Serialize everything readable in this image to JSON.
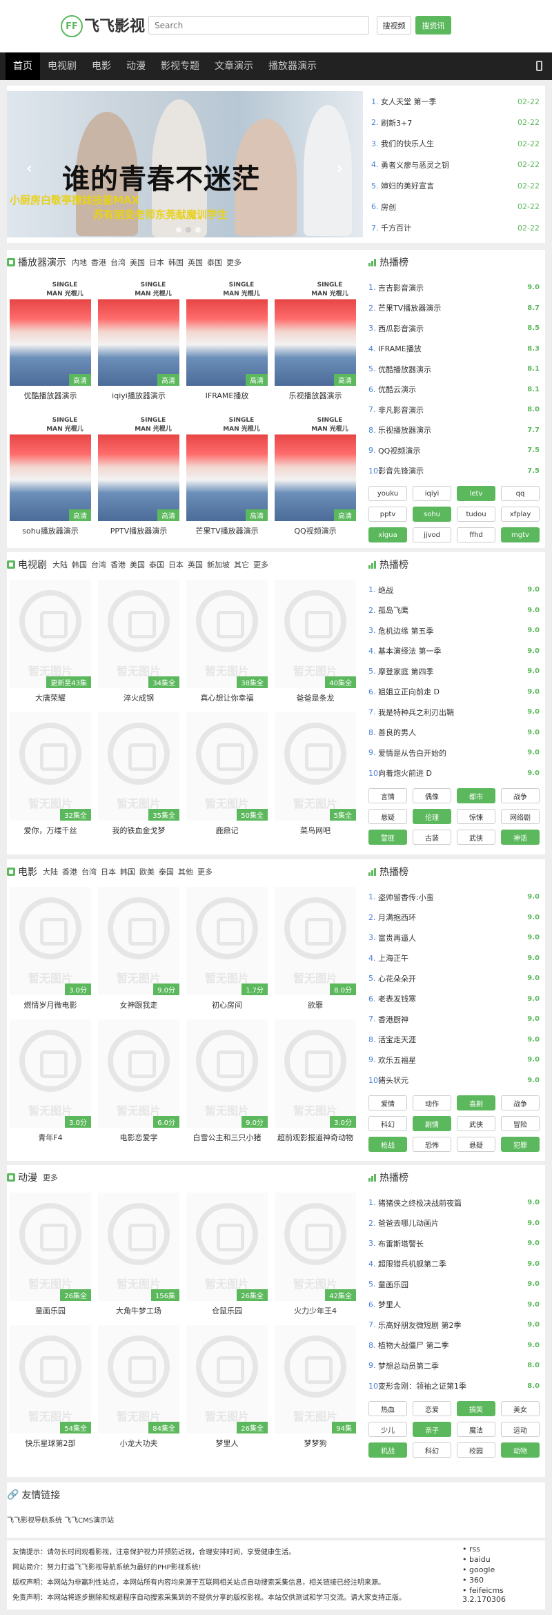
{
  "header": {
    "logo_mark": "FF",
    "site_name": "飞飞影视",
    "search_placeholder": "Search",
    "search_button": "搜视频",
    "search_button2": "搜资讯"
  },
  "nav": [
    "首页",
    "电视剧",
    "电影",
    "动漫",
    "影视专题",
    "文章演示",
    "播放器演示"
  ],
  "slider": {
    "title": "谁的青春不迷茫",
    "sub1": "小厨房白敬亭撩妹技能MAX",
    "sub2": "苏有朋变老师东莞献魔训学生"
  },
  "top_list": [
    {
      "title": "女人天堂 第一季",
      "date": "02-22"
    },
    {
      "title": "刷新3+7",
      "date": "02-22"
    },
    {
      "title": "我们的快乐人生",
      "date": "02-22"
    },
    {
      "title": "勇者义瘳与恶灵之钥",
      "date": "02-22"
    },
    {
      "title": "婶妇的美好宣言",
      "date": "02-22"
    },
    {
      "title": "房创",
      "date": "02-22"
    },
    {
      "title": "千方百计",
      "date": "02-22"
    }
  ],
  "hot_title": "热播榜",
  "no_image_text": "暂无图片",
  "sections": [
    {
      "title": "播放器演示",
      "links": [
        "内地",
        "香港",
        "台湾",
        "美国",
        "日本",
        "韩国",
        "英国",
        "泰国",
        "更多"
      ],
      "poster_text": "SINGLE MAN 光棍儿",
      "items": [
        {
          "caption": "优酷播放器演示",
          "badge": "高清"
        },
        {
          "caption": "iqiyi播放器演示",
          "badge": "高清"
        },
        {
          "caption": "IFRAME播放",
          "badge": "高清"
        },
        {
          "caption": "乐视播放器演示",
          "badge": "高清"
        },
        {
          "caption": "sohu播放器演示",
          "badge": "高清"
        },
        {
          "caption": "PPTV播放器演示",
          "badge": "高清"
        },
        {
          "caption": "芒果TV播放器演示",
          "badge": "高清"
        },
        {
          "caption": "QQ视频演示",
          "badge": "高清"
        }
      ],
      "hot": [
        {
          "title": "吉吉影音演示",
          "score": "9.0"
        },
        {
          "title": "芒果TV播放器演示",
          "score": "8.7"
        },
        {
          "title": "西瓜影音演示",
          "score": "8.5"
        },
        {
          "title": "IFRAME播放",
          "score": "8.3"
        },
        {
          "title": "优酷播放器演示",
          "score": "8.1"
        },
        {
          "title": "优酷云演示",
          "score": "8.1"
        },
        {
          "title": "非凡影音演示",
          "score": "8.0"
        },
        {
          "title": "乐视播放器演示",
          "score": "7.7"
        },
        {
          "title": "QQ视频演示",
          "score": "7.5"
        },
        {
          "title": "影音先锋演示",
          "score": "7.5"
        }
      ],
      "tags": [
        {
          "t": "youku",
          "g": false
        },
        {
          "t": "iqiyi",
          "g": false
        },
        {
          "t": "letv",
          "g": true
        },
        {
          "t": "qq",
          "g": false
        },
        {
          "t": "pptv",
          "g": false
        },
        {
          "t": "sohu",
          "g": true
        },
        {
          "t": "tudou",
          "g": false
        },
        {
          "t": "xfplay",
          "g": false
        },
        {
          "t": "xigua",
          "g": true
        },
        {
          "t": "jjvod",
          "g": false
        },
        {
          "t": "ffhd",
          "g": false
        },
        {
          "t": "mgtv",
          "g": true
        }
      ]
    },
    {
      "title": "电视剧",
      "links": [
        "大陆",
        "韩国",
        "台湾",
        "香港",
        "美国",
        "泰国",
        "日本",
        "英国",
        "新加坡",
        "其它",
        "更多"
      ],
      "items": [
        {
          "caption": "大唐荣耀",
          "badge": "更新至43集"
        },
        {
          "caption": "淬火成钢",
          "badge": "34集全"
        },
        {
          "caption": "真心想让你幸福",
          "badge": "38集全"
        },
        {
          "caption": "爸爸是条龙",
          "badge": "40集全"
        },
        {
          "caption": "爱你，万缕千丝",
          "badge": "32集全"
        },
        {
          "caption": "我的铁血金戈梦",
          "badge": "35集全"
        },
        {
          "caption": "鹿鼎记",
          "badge": "50集全"
        },
        {
          "caption": "菜鸟网吧",
          "badge": "5集全"
        }
      ],
      "hot": [
        {
          "title": "绝战",
          "score": "9.0"
        },
        {
          "title": "孤岛飞鹰",
          "score": "9.0"
        },
        {
          "title": "危机边缘 第五季",
          "score": "9.0"
        },
        {
          "title": "基本演绎法 第一季",
          "score": "9.0"
        },
        {
          "title": "摩登家庭 第四季",
          "score": "9.0"
        },
        {
          "title": "姐姐立正向前走 D",
          "score": "9.0"
        },
        {
          "title": "我是特种兵之利刃出鞘",
          "score": "9.0"
        },
        {
          "title": "善良的男人",
          "score": "9.0"
        },
        {
          "title": "爱情是从告白开始的",
          "score": "9.0"
        },
        {
          "title": "向着炮火前进 D",
          "score": "9.0"
        }
      ],
      "tags": [
        {
          "t": "言情",
          "g": false
        },
        {
          "t": "偶像",
          "g": false
        },
        {
          "t": "都市",
          "g": true
        },
        {
          "t": "战争",
          "g": false
        },
        {
          "t": "悬疑",
          "g": false
        },
        {
          "t": "伦理",
          "g": true
        },
        {
          "t": "惊悚",
          "g": false
        },
        {
          "t": "网络剧",
          "g": false
        },
        {
          "t": "警匪",
          "g": true
        },
        {
          "t": "古装",
          "g": false
        },
        {
          "t": "武侠",
          "g": false
        },
        {
          "t": "神话",
          "g": true
        }
      ]
    },
    {
      "title": "电影",
      "links": [
        "大陆",
        "香港",
        "台湾",
        "日本",
        "韩国",
        "欧美",
        "泰国",
        "其他",
        "更多"
      ],
      "items": [
        {
          "caption": "燃情岁月微电影",
          "badge": "3.0分"
        },
        {
          "caption": "女神跟我走",
          "badge": "9.0分"
        },
        {
          "caption": "初心房间",
          "badge": "1.7分"
        },
        {
          "caption": "欲罪",
          "badge": "8.0分"
        },
        {
          "caption": "青年F4",
          "badge": "3.0分"
        },
        {
          "caption": "电影恋爱学",
          "badge": "6.0分"
        },
        {
          "caption": "白雪公主和三只小猪",
          "badge": "9.0分"
        },
        {
          "caption": "超前观影报道神奇动物",
          "badge": "3.0分"
        }
      ],
      "hot": [
        {
          "title": "盗帅留香传:小蛮",
          "score": "9.0"
        },
        {
          "title": "月满抱西环",
          "score": "9.0"
        },
        {
          "title": "富贵再逼人",
          "score": "9.0"
        },
        {
          "title": "上海正午",
          "score": "9.0"
        },
        {
          "title": "心花朵朵开",
          "score": "9.0"
        },
        {
          "title": "老表发钱寒",
          "score": "9.0"
        },
        {
          "title": "香港厨神",
          "score": "9.0"
        },
        {
          "title": "活宝走天涯",
          "score": "9.0"
        },
        {
          "title": "欢乐五福星",
          "score": "9.0"
        },
        {
          "title": "猪头状元",
          "score": "9.0"
        }
      ],
      "tags": [
        {
          "t": "爱情",
          "g": false
        },
        {
          "t": "动作",
          "g": false
        },
        {
          "t": "喜剧",
          "g": true
        },
        {
          "t": "战争",
          "g": false
        },
        {
          "t": "科幻",
          "g": false
        },
        {
          "t": "剧情",
          "g": true
        },
        {
          "t": "武侠",
          "g": false
        },
        {
          "t": "冒险",
          "g": false
        },
        {
          "t": "枪战",
          "g": true
        },
        {
          "t": "恐怖",
          "g": false
        },
        {
          "t": "悬疑",
          "g": false
        },
        {
          "t": "犯罪",
          "g": true
        }
      ]
    },
    {
      "title": "动漫",
      "links": [
        "更多"
      ],
      "items": [
        {
          "caption": "童画乐园",
          "badge": "26集全"
        },
        {
          "caption": "大角牛梦工场",
          "badge": "156集"
        },
        {
          "caption": "仓鼠乐园",
          "badge": "26集全"
        },
        {
          "caption": "火力少年王4",
          "badge": "42集全"
        },
        {
          "caption": "快乐星球第2部",
          "badge": "54集全"
        },
        {
          "caption": "小龙大功夫",
          "badge": "84集全"
        },
        {
          "caption": "梦里人",
          "badge": "26集全"
        },
        {
          "caption": "梦梦狗",
          "badge": "94集"
        }
      ],
      "hot": [
        {
          "title": "猪猪侠之终极决战前夜篇",
          "score": "9.0"
        },
        {
          "title": "爸爸去哪儿动画片",
          "score": "9.0"
        },
        {
          "title": "布雷斯塔警长",
          "score": "9.0"
        },
        {
          "title": "超限猎兵机舰第二季",
          "score": "9.0"
        },
        {
          "title": "童画乐园",
          "score": "9.0"
        },
        {
          "title": "梦里人",
          "score": "9.0"
        },
        {
          "title": "乐高好朋友微短剧 第2季",
          "score": "9.0"
        },
        {
          "title": "植物大战僵尸 第二季",
          "score": "9.0"
        },
        {
          "title": "梦想总动员第二季",
          "score": "8.0"
        },
        {
          "title": "变形金刚：领袖之证第1季",
          "score": "8.0"
        }
      ],
      "tags": [
        {
          "t": "热血",
          "g": false
        },
        {
          "t": "恋爱",
          "g": false
        },
        {
          "t": "搞笑",
          "g": true
        },
        {
          "t": "美女",
          "g": false
        },
        {
          "t": "少儿",
          "g": false
        },
        {
          "t": "亲子",
          "g": true
        },
        {
          "t": "魔法",
          "g": false
        },
        {
          "t": "运动",
          "g": false
        },
        {
          "t": "机战",
          "g": true
        },
        {
          "t": "科幻",
          "g": false
        },
        {
          "t": "校园",
          "g": false
        },
        {
          "t": "动物",
          "g": true
        }
      ]
    }
  ],
  "links": {
    "title": "友情链接",
    "items": "飞飞影视导航系统  飞飞CMS演示站"
  },
  "footer": {
    "lines": [
      "友情提示：请勿长时间观看影视，注意保护视力并预防近视，合理安排时间，享受健康生活。",
      "网站简介：努力打造飞飞影视导航系统为最好的PHP影视系统!",
      "版权声明：本网站为非赢利性站点，本网站所有内容均来源于互联网相关站点自动搜索采集信息，相关链接已经注明来源。",
      "免责声明：本网站将逐步删除和规避程序自动搜索采集到的不提供分享的版权影视。本站仅供测试和学习交流。请大家支持正版。"
    ],
    "links": [
      "rss",
      "baidu",
      "google",
      "360",
      "feifeicms 3.2.170306"
    ]
  }
}
